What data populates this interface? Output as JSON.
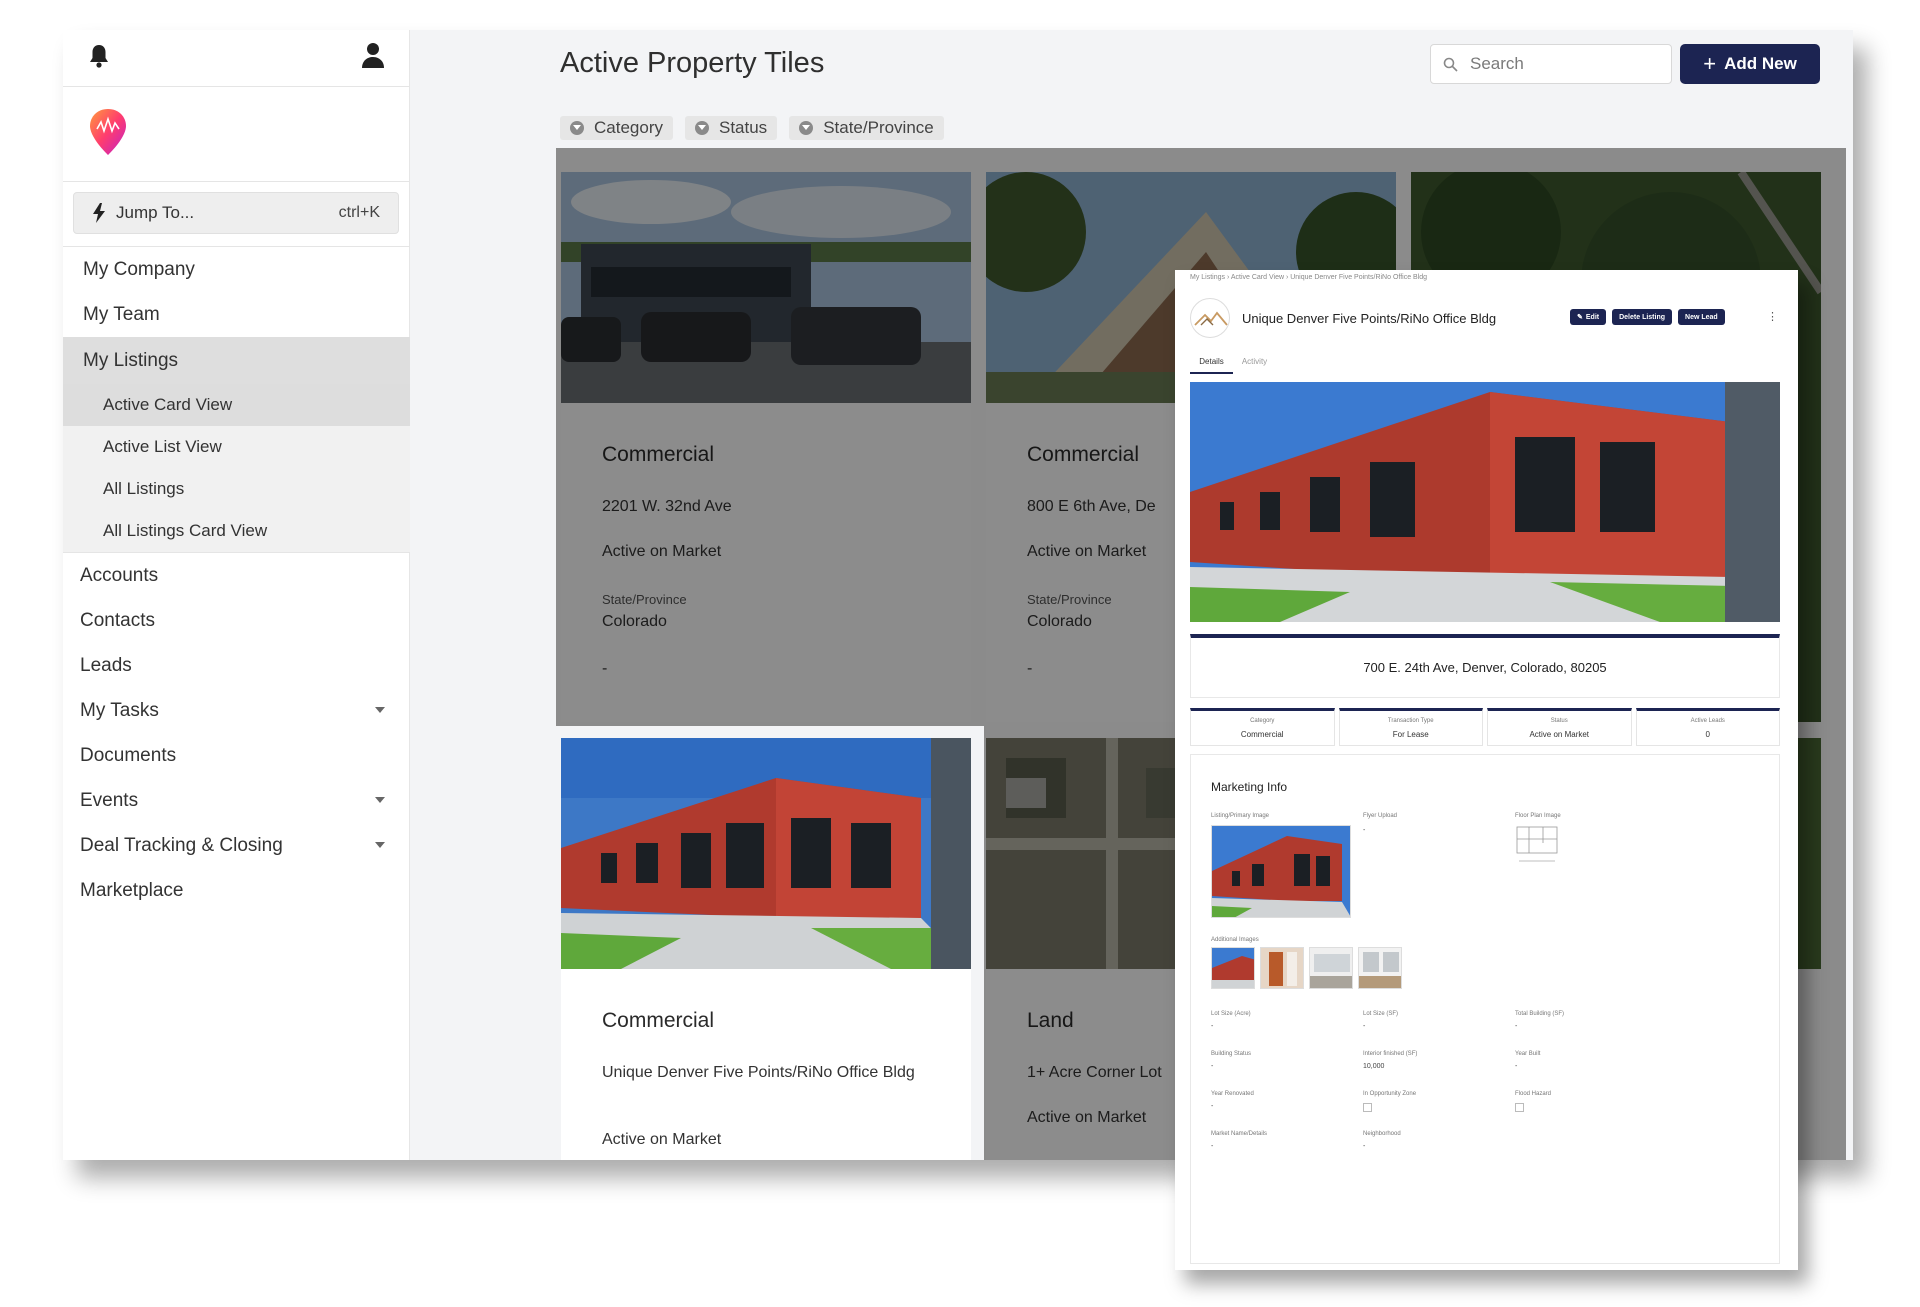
{
  "sidebar": {
    "jump": {
      "label": "Jump To...",
      "shortcut": "ctrl+K"
    },
    "top_items": [
      "My Company",
      "My Team"
    ],
    "section": {
      "label": "My Listings",
      "subs": [
        "Active Card View",
        "Active List View",
        "All Listings",
        "All Listings Card View"
      ]
    },
    "items": [
      {
        "label": "Accounts",
        "caret": false
      },
      {
        "label": "Contacts",
        "caret": false
      },
      {
        "label": "Leads",
        "caret": false
      },
      {
        "label": "My Tasks",
        "caret": true
      },
      {
        "label": "Documents",
        "caret": false
      },
      {
        "label": "Events",
        "caret": true
      },
      {
        "label": "Deal Tracking & Closing",
        "caret": true
      },
      {
        "label": "Marketplace",
        "caret": false
      }
    ]
  },
  "header": {
    "title": "Active Property Tiles",
    "search_placeholder": "Search",
    "add_label": "Add New",
    "filters": [
      "Category",
      "Status",
      "State/Province"
    ]
  },
  "cards": [
    {
      "category": "Commercial",
      "address": "2201 W. 32nd Ave",
      "status": "Active on Market",
      "state_label": "State/Province",
      "state": "Colorado",
      "extra": "-"
    },
    {
      "category": "Commercial",
      "address": "800 E 6th Ave, De",
      "status": "Active on Market",
      "state_label": "State/Province",
      "state": "Colorado",
      "extra": "-"
    },
    {
      "category": "Commercial",
      "address": "Unique Denver Five Points/RiNo Office Bldg",
      "status": "Active on Market"
    },
    {
      "category": "Land",
      "address": "1+ Acre Corner Lot",
      "status": "Active on Market"
    }
  ],
  "detail": {
    "breadcrumb": "My Listings  ›  Active Card View  ›  Unique Denver Five Points/RiNo Office Bldg",
    "title": "Unique Denver Five Points/RiNo Office Bldg",
    "buttons": [
      "Edit",
      "Delete Listing",
      "New Lead"
    ],
    "tabs": [
      "Details",
      "Activity"
    ],
    "address": "700 E. 24th Ave, Denver, Colorado, 80205",
    "stats": [
      {
        "k": "Category",
        "v": "Commercial"
      },
      {
        "k": "Transaction Type",
        "v": "For Lease"
      },
      {
        "k": "Status",
        "v": "Active on Market"
      },
      {
        "k": "Active Leads",
        "v": "0"
      }
    ],
    "marketing": {
      "title": "Marketing Info",
      "primary_label": "Listing/Primary Image",
      "flyer_label": "Flyer Upload",
      "flyer_value": "-",
      "floor_label": "Floor Plan Image",
      "additional_label": "Additional Images",
      "fields": [
        {
          "k": "Lot Size (Acre)",
          "v": "-"
        },
        {
          "k": "Lot Size (SF)",
          "v": "-"
        },
        {
          "k": "Total Building (SF)",
          "v": "-"
        },
        {
          "k": "Building Status",
          "v": "-"
        },
        {
          "k": "Interior finished (SF)",
          "v": "10,000"
        },
        {
          "k": "Year Built",
          "v": "-"
        },
        {
          "k": "Year Renovated",
          "v": "-"
        },
        {
          "k": "In Opportunity Zone",
          "v": ""
        },
        {
          "k": "Flood Hazard",
          "v": ""
        },
        {
          "k": "Market Name/Details",
          "v": "-"
        },
        {
          "k": "Neighborhood",
          "v": "-"
        }
      ]
    }
  },
  "colors": {
    "accent": "#1c2452",
    "selected": "#dddddd",
    "brick": "#b03a2e"
  }
}
